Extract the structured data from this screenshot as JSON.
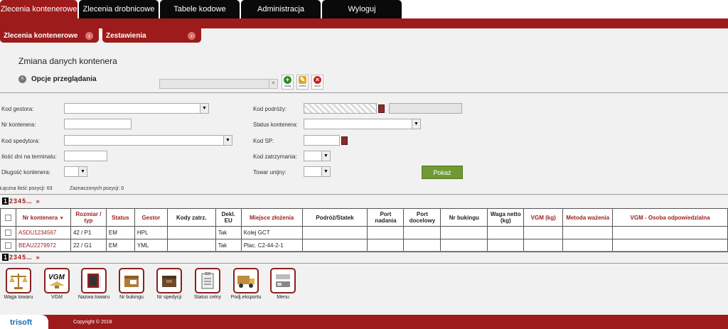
{
  "top_tabs": [
    "Zlecenia kontenerowe",
    "Zlecenia drobnicowe",
    "Tabele kodowe",
    "Administracja",
    "Wyloguj"
  ],
  "sub_tabs": [
    "Zlecenia kontenerowe",
    "Zestawienia"
  ],
  "page_title": "Zmiana danych kontenera",
  "options_label": "Opcje przeglądania",
  "mini_buttons": [
    "dodaj",
    "zmień",
    "usuń"
  ],
  "form": {
    "kod_gestora": "Kod gestora:",
    "nr_kontenera": "Nr kontenera:",
    "kod_spedytora": "Kod spedytora:",
    "ilosc_dni": "Ilość dni na terminalu:",
    "dlugosc": "Długość kontenera:",
    "kod_podrozy": "Kod podróży:",
    "status_kontenera": "Status kontenera:",
    "kod_sp": "Kod SP:",
    "kod_zatrzymania": "Kod zatrzymania:",
    "towar_unijny": "Towar unijny:",
    "pokaz": "Pokaż"
  },
  "counts": {
    "total": "Łączna ilość pozycji: 63",
    "selected": "Zaznaczonych pozycji: 0"
  },
  "pager": {
    "current": "1",
    "pages": [
      "2",
      "3",
      "4",
      "5",
      "..."
    ],
    "next": "»"
  },
  "table": {
    "headers": [
      "Nr kontenera",
      "Rozmiar / typ",
      "Status",
      "Gestor",
      "Kody zatrz.",
      "Dekl. EU",
      "Miejsce złożenia",
      "Podróż/Statek",
      "Port nadania",
      "Port docelowy",
      "Nr bukingu",
      "Waga netto (kg)",
      "VGM (kg)",
      "Metoda ważenia",
      "VGM - Osoba odpowiedzialna"
    ],
    "rows": [
      [
        "ASDU1234567",
        "42 / P1",
        "EM",
        "HPL",
        "",
        "Tak",
        "Kolej GCT",
        "",
        "",
        "",
        "",
        "",
        "",
        "",
        ""
      ],
      [
        "BEAU2279972",
        "22 / G1",
        "EM",
        "YML",
        "",
        "Tak",
        "Plac. C2-44-2-1",
        "",
        "",
        "",
        "",
        "",
        "",
        "",
        ""
      ]
    ]
  },
  "tools": [
    "Waga towaru",
    "VGM",
    "Nazwa towaru",
    "Nr bukingu",
    "Nr spedycji",
    "Status celny",
    "Podj.eksportu",
    "Menu"
  ],
  "footer": {
    "logo": "trisoft",
    "copyright": "Copyright © 2018"
  },
  "colors": {
    "brand": "#9e1b1b",
    "button_green": "#6f9a33"
  }
}
